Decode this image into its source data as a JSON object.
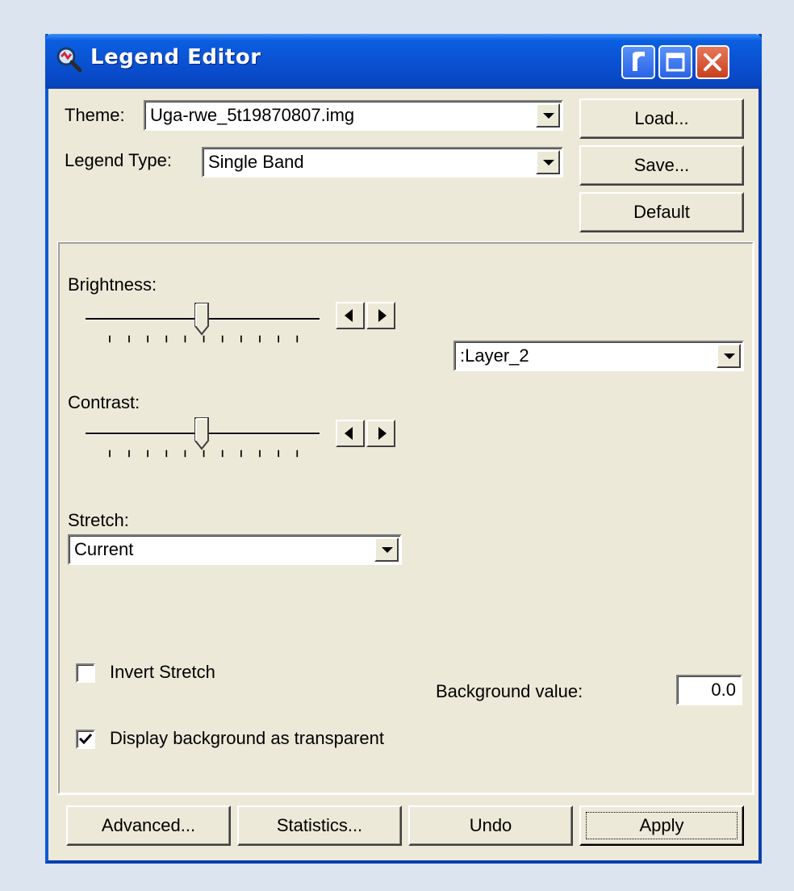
{
  "window": {
    "title": "Legend Editor"
  },
  "header": {
    "theme_label": "Theme:",
    "theme_value": "Uga-rwe_5t19870807.img",
    "legend_type_label": "Legend Type:",
    "legend_type_value": "Single Band"
  },
  "side_buttons": {
    "load": "Load...",
    "save": "Save...",
    "default": "Default"
  },
  "panel": {
    "brightness_label": "Brightness:",
    "contrast_label": "Contrast:",
    "brightness_level": 0.5,
    "contrast_level": 0.5,
    "layer_value": ":Layer_2",
    "stretch_label": "Stretch:",
    "stretch_value": "Current",
    "invert_stretch_label": "Invert Stretch",
    "invert_stretch_checked": false,
    "transparent_label": "Display background as transparent",
    "transparent_checked": true,
    "background_value_label": "Background value:",
    "background_value": "0.0"
  },
  "footer": {
    "advanced": "Advanced...",
    "statistics": "Statistics...",
    "undo": "Undo",
    "apply": "Apply"
  }
}
